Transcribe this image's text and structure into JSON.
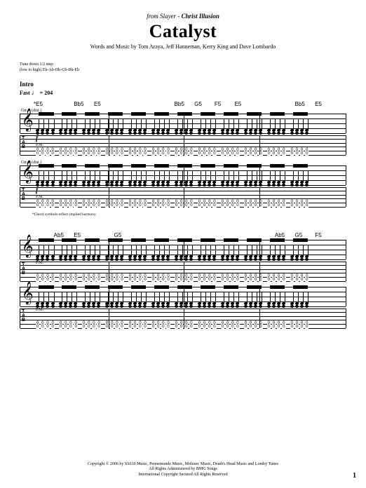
{
  "header": {
    "source_prefix": "from",
    "artist": "Slayer",
    "dash": " - ",
    "album": "Christ Illusion",
    "title": "Catalyst",
    "credits": "Words and Music by Tom Araya, Jeff Hanneman, Kerry King and Dave Lombardo"
  },
  "tuning": {
    "line1": "Tune down 1/2 step:",
    "line2": "(low to high) Eb-Ab-Db-Gb-Bb-Eb"
  },
  "section": {
    "label": "Intro",
    "tempo_prefix": "Fast",
    "tempo_value": "= 204"
  },
  "parts": {
    "gtr1": "Gtr. 1 (dist.)",
    "gtr2": "Gtr. 2 (dist.)"
  },
  "chords_sys1": [
    "*E5",
    "",
    "Bb5",
    "E5",
    "",
    "",
    "",
    "Bb5",
    "G5",
    "F5",
    "E5",
    "",
    "",
    "Bb5",
    "E5"
  ],
  "chords_sys2": [
    "",
    "Ab5",
    "E5",
    "",
    "G5",
    "",
    "",
    "",
    "",
    "",
    "",
    "",
    "Ab5",
    "G5",
    "F5"
  ],
  "dynamics": {
    "f": "f"
  },
  "markings": {
    "pm": "P.M."
  },
  "tab_label": "T\nA\nB",
  "footnote": "*Chord symbols reflect implied harmony.",
  "copyright": {
    "line1": "Copyright © 2006 by SS610 Music, Pennemunde Music, Molusec Music, Death's Head Music and Lomby Tunes",
    "line2": "All Rights Administered by BMG Songs",
    "line3": "International Copyright Secured   All Rights Reserved"
  },
  "page_number": "1"
}
